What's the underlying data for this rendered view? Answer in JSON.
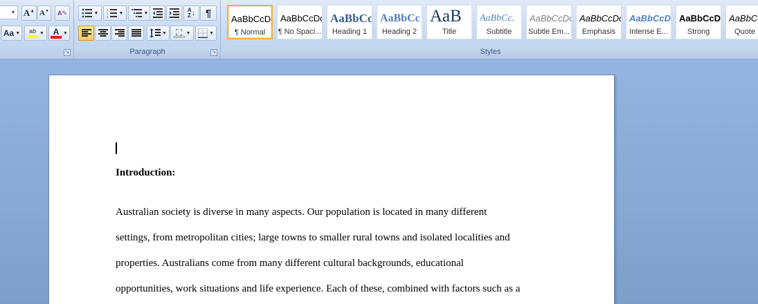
{
  "ribbon": {
    "groups": {
      "paragraph": {
        "caption": "Paragraph"
      },
      "styles": {
        "caption": "Styles"
      }
    },
    "font": {
      "grow_label": "A",
      "shrink_label": "A",
      "case_label": "Aa",
      "highlight_label": "ab",
      "font_color_label": "A",
      "font_color": "#e02020",
      "highlight_color": "#ffff00"
    },
    "styles": [
      {
        "sample": "AaBbCcDc",
        "name": "¶ Normal",
        "selected": true
      },
      {
        "sample": "AaBbCcDc",
        "name": "¶ No Spaci...",
        "selected": false
      },
      {
        "sample": "AaBbCc",
        "name": "Heading 1",
        "selected": false
      },
      {
        "sample": "AaBbCc",
        "name": "Heading 2",
        "selected": false
      },
      {
        "sample": "AaB",
        "name": "Title",
        "selected": false
      },
      {
        "sample": "AaBbCc.",
        "name": "Subtitle",
        "selected": false
      },
      {
        "sample": "AaBbCcDc",
        "name": "Subtle Em...",
        "selected": false
      },
      {
        "sample": "AaBbCcDc",
        "name": "Emphasis",
        "selected": false
      },
      {
        "sample": "AaBbCcDc",
        "name": "Intense E...",
        "selected": false
      },
      {
        "sample": "AaBbCcDc",
        "name": "Strong",
        "selected": false
      },
      {
        "sample": "AaBbCc",
        "name": "Quote",
        "selected": false
      }
    ]
  },
  "document": {
    "heading": "Introduction:",
    "lines": [
      "Australian society is  diverse in many aspects. Our population is located in many different",
      "settings, from metropolitan  cities; large towns to smaller rural towns and isolated localities  and",
      "properties. Australians  come  from many different cultural backgrounds, educational",
      "opportunities, work situations and life experience.  Each of these, combined with factors such as a"
    ]
  }
}
